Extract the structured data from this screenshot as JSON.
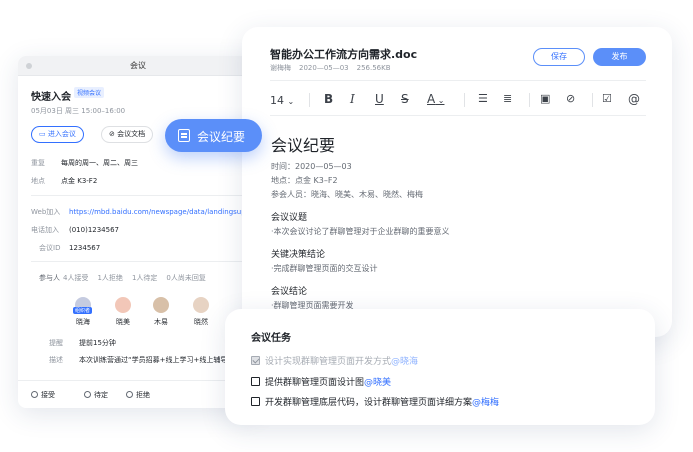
{
  "meeting": {
    "window_title": "会议",
    "title": "快速入会",
    "badge": "视频会议",
    "time": "05月03日 周三 15:00–16:00",
    "join_button": "进入会议",
    "docs_button": "会议文档",
    "repeat_label": "重复",
    "repeat_value": "每周的周一、周二、周三",
    "location_label": "地点",
    "location_value": "点金 K3-F2",
    "web_label": "Web加入",
    "web_value": "https://mbd.baidu.com/newspage/data/landingsuper",
    "phone_label": "电话加入",
    "phone_value": "(010)1234567",
    "id_label": "会议ID",
    "id_value": "1234567",
    "participants_label": "参与人",
    "counts": [
      "4人接受",
      "1人拒绝",
      "1人待定",
      "0人尚未回复"
    ],
    "host_tag": "组织者",
    "attendees": [
      "晓海",
      "晓美",
      "木易",
      "晓然"
    ],
    "remind_label": "提醒",
    "remind_value": "提前15分钟",
    "desc_label": "描述",
    "desc_value": "本次训练营通过“学员招募+线上学习+线上辅导",
    "footer": {
      "accept": "接受",
      "pending": "待定",
      "decline": "拒绝"
    }
  },
  "chip": {
    "label": "会议纪要"
  },
  "editor": {
    "doc_title": "智能办公工作流方向需求.doc",
    "author": "谢梅梅",
    "date": "2020—05—03",
    "size": "256.56KB",
    "save": "保存",
    "publish": "发布",
    "font_size": "14",
    "heading": "会议纪要",
    "time_line": "时间：2020—05—03",
    "place_line": "地点：点金 K3–F2",
    "people_line": "参会人员：晓海、晓美、木易、晓然、梅梅",
    "sections": [
      {
        "title": "会议议题",
        "text": "·本次会议讨论了群聊管理对于企业群聊的重要意义"
      },
      {
        "title": "关键决策结论",
        "text": "·完成群聊管理页面的交互设计"
      },
      {
        "title": "会议结论",
        "text": "·群聊管理页面需要开发"
      }
    ]
  },
  "tasks": {
    "title": "会议任务",
    "items": [
      {
        "text": "设计实现群聊管理页面开发方式",
        "mention": "@晓海",
        "done": true
      },
      {
        "text": "提供群聊管理页面设计图",
        "mention": "@晓美",
        "done": false
      },
      {
        "text": "开发群聊管理底层代码，设计群聊管理页面详细方案",
        "mention": "@梅梅",
        "done": false
      }
    ]
  },
  "colors": {
    "accent": "#3370ff",
    "chip": "#5b8ff9"
  }
}
